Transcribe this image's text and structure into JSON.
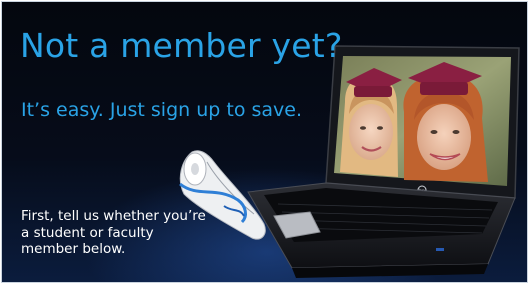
{
  "banner": {
    "headline": "Not a member yet?",
    "subhead": "It’s easy. Just sign up to save.",
    "body_copy": "First, tell us whether you’re a student or faculty member below."
  },
  "laptop": {
    "brand_logo": "hp"
  },
  "colors": {
    "accent_blue": "#2aa3e6",
    "background": "#04070e",
    "body_text": "#ffffff",
    "graduation_cap": "#8a1f42"
  }
}
